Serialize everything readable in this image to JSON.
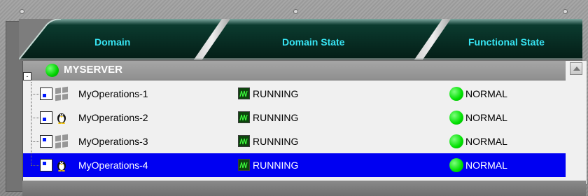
{
  "header": {
    "columns": [
      {
        "label": "Domain"
      },
      {
        "label": "Domain State"
      },
      {
        "label": "Functional State"
      }
    ]
  },
  "server": {
    "label": "MYSERVER",
    "collapse_symbol": "-",
    "status_color": "#00d100"
  },
  "rows": [
    {
      "name": "MyOperations-1",
      "os": "windows",
      "domain_state": "RUNNING",
      "functional_state": "NORMAL",
      "selected": false
    },
    {
      "name": "MyOperations-2",
      "os": "linux",
      "domain_state": "RUNNING",
      "functional_state": "NORMAL",
      "selected": false
    },
    {
      "name": "MyOperations-3",
      "os": "windows",
      "domain_state": "RUNNING",
      "functional_state": "NORMAL",
      "selected": false
    },
    {
      "name": "MyOperations-4",
      "os": "linux",
      "domain_state": "RUNNING",
      "functional_state": "NORMAL",
      "selected": true
    }
  ],
  "colors": {
    "header_bg": "#083225",
    "header_text": "#37e5f2",
    "selection": "#0000f2",
    "status_green": "#00e000"
  },
  "icons": {
    "collapse": "minus-box-icon",
    "server_status": "status-dot-icon",
    "windows": "windows-logo-icon",
    "linux": "linux-penguin-icon",
    "running": "running-monitor-icon",
    "normal": "green-status-dot-icon",
    "scroll_up": "scroll-up-arrow-icon"
  }
}
